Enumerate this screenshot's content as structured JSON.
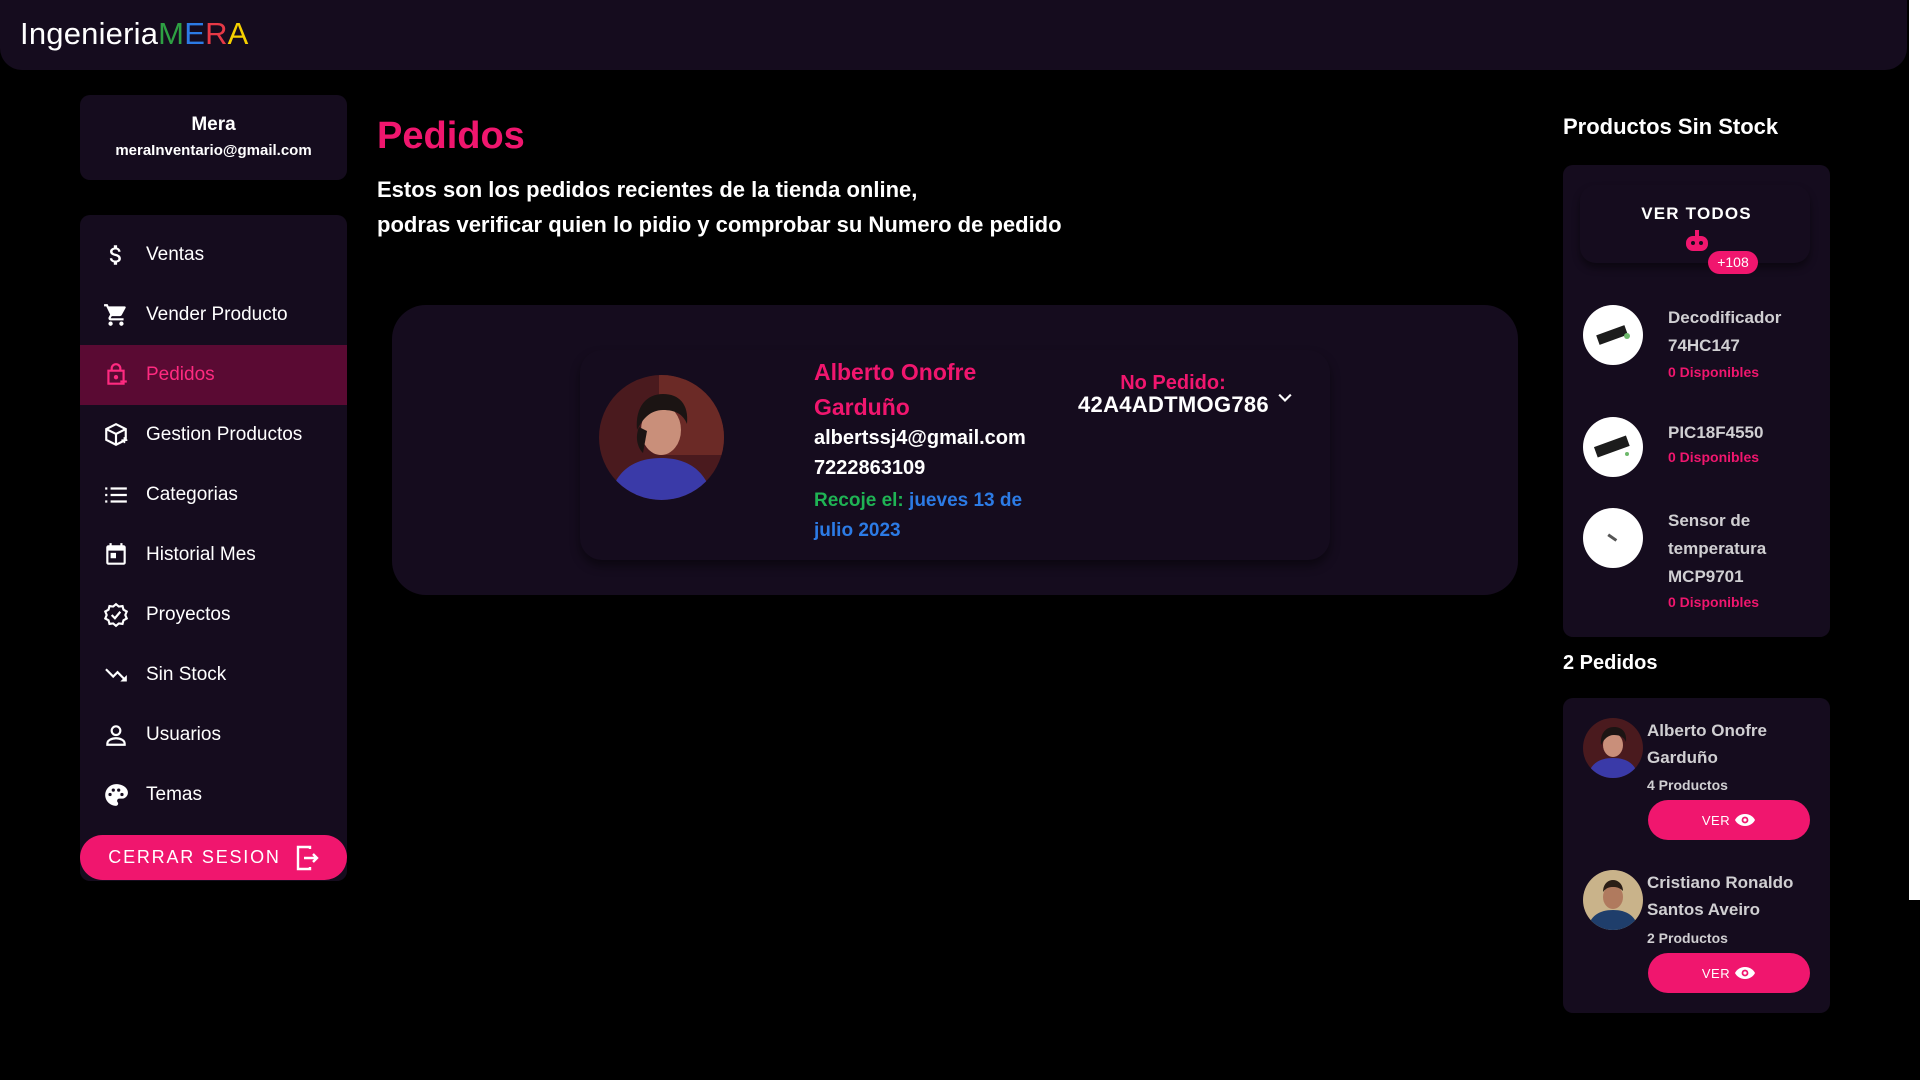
{
  "app": {
    "brand_prefix": "Ingenieria",
    "brand_letters": [
      {
        "char": "M",
        "color": "#2ea043"
      },
      {
        "char": "E",
        "color": "#2c7be5"
      },
      {
        "char": "R",
        "color": "#e63946"
      },
      {
        "char": "A",
        "color": "#f5d000"
      }
    ]
  },
  "colors": {
    "accent": "#f0166e",
    "panel": "#150c1e",
    "active_bg": "#5a0a33",
    "green": "#1fb354",
    "blue": "#2c7be5"
  },
  "user": {
    "name": "Mera",
    "email": "meraInventario@gmail.com"
  },
  "sidebar": {
    "items": [
      {
        "label": "Ventas",
        "icon": "dollar-icon",
        "active": false
      },
      {
        "label": "Vender Producto",
        "icon": "cart-icon",
        "active": false
      },
      {
        "label": "Pedidos",
        "icon": "order-icon",
        "active": true
      },
      {
        "label": "Gestion Productos",
        "icon": "package-add-icon",
        "active": false
      },
      {
        "label": "Categorias",
        "icon": "list-icon",
        "active": false
      },
      {
        "label": "Historial Mes",
        "icon": "calendar-icon",
        "active": false
      },
      {
        "label": "Proyectos",
        "icon": "verified-icon",
        "active": false
      },
      {
        "label": "Sin Stock",
        "icon": "trending-down-icon",
        "active": false
      },
      {
        "label": "Usuarios",
        "icon": "person-icon",
        "active": false
      },
      {
        "label": "Temas",
        "icon": "palette-icon",
        "active": false
      }
    ],
    "logout_label": "CERRAR SESION"
  },
  "main": {
    "title": "Pedidos",
    "description_line1": "Estos son los pedidos recientes de la tienda online,",
    "description_line2": "podras verificar quien lo pidio y comprobar su Numero de pedido",
    "order": {
      "customer_name": "Alberto Onofre Garduño",
      "email": "albertssj4@gmail.com",
      "phone": "7222863109",
      "pickup_label": "Recoje el:",
      "pickup_date": "jueves 13 de julio 2023",
      "order_number_label": "No Pedido:",
      "order_number": "42A4ADTMOG786"
    }
  },
  "right": {
    "out_of_stock_title": "Productos Sin Stock",
    "view_all_label": "VER TODOS",
    "badge_count": "+108",
    "products": [
      {
        "name": "Decodificador 74HC147",
        "stock": "0 Disponibles"
      },
      {
        "name": "PIC18F4550",
        "stock": "0 Disponibles"
      },
      {
        "name": "Sensor de temperatura MCP9701",
        "stock": "0 Disponibles"
      }
    ],
    "orders_title": "2 Pedidos",
    "orders": [
      {
        "name": "Alberto Onofre Garduño",
        "count": "4 Productos",
        "button": "VER"
      },
      {
        "name": "Cristiano Ronaldo Santos Aveiro",
        "count": "2 Productos",
        "button": "VER"
      }
    ]
  }
}
